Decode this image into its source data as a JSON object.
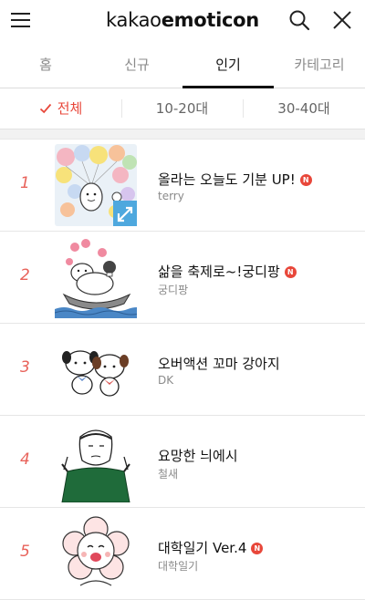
{
  "header": {
    "brand_left": "kakao",
    "brand_right": "emoticon",
    "icons": [
      "hamburger-menu-icon",
      "search-icon",
      "close-icon"
    ]
  },
  "tabs": [
    {
      "label": "홈",
      "active": false
    },
    {
      "label": "신규",
      "active": false
    },
    {
      "label": "인기",
      "active": true
    },
    {
      "label": "카테고리",
      "active": false
    }
  ],
  "filters": [
    {
      "label": "전체",
      "active": true
    },
    {
      "label": "10-20대",
      "active": false
    },
    {
      "label": "30-40대",
      "active": false
    }
  ],
  "colors": {
    "accent": "#e8473a",
    "rank": "#e8625a",
    "new_badge": "#e8473a",
    "inactive_text": "#8a8a8a"
  },
  "badge_new": "N",
  "items": [
    {
      "rank": "1",
      "title": "올라는 오늘도 기분 UP!",
      "author": "terry",
      "is_new": true,
      "thumbnail": "balloons-character-thumbnail",
      "animated": true
    },
    {
      "rank": "2",
      "title": "삶을 축제로~!궁디팡",
      "author": "궁디팡",
      "is_new": true,
      "thumbnail": "boat-rabbit-thumbnail",
      "animated": false
    },
    {
      "rank": "3",
      "title": "오버액션 꼬마 강아지",
      "author": "DK",
      "is_new": false,
      "thumbnail": "two-puppies-thumbnail",
      "animated": false
    },
    {
      "rank": "4",
      "title": "요망한 늬에시",
      "author": "철새",
      "is_new": false,
      "thumbnail": "sketch-man-thumbnail",
      "animated": false
    },
    {
      "rank": "5",
      "title": "대학일기 Ver.4",
      "author": "대학일기",
      "is_new": true,
      "thumbnail": "flower-face-thumbnail",
      "animated": false
    }
  ]
}
